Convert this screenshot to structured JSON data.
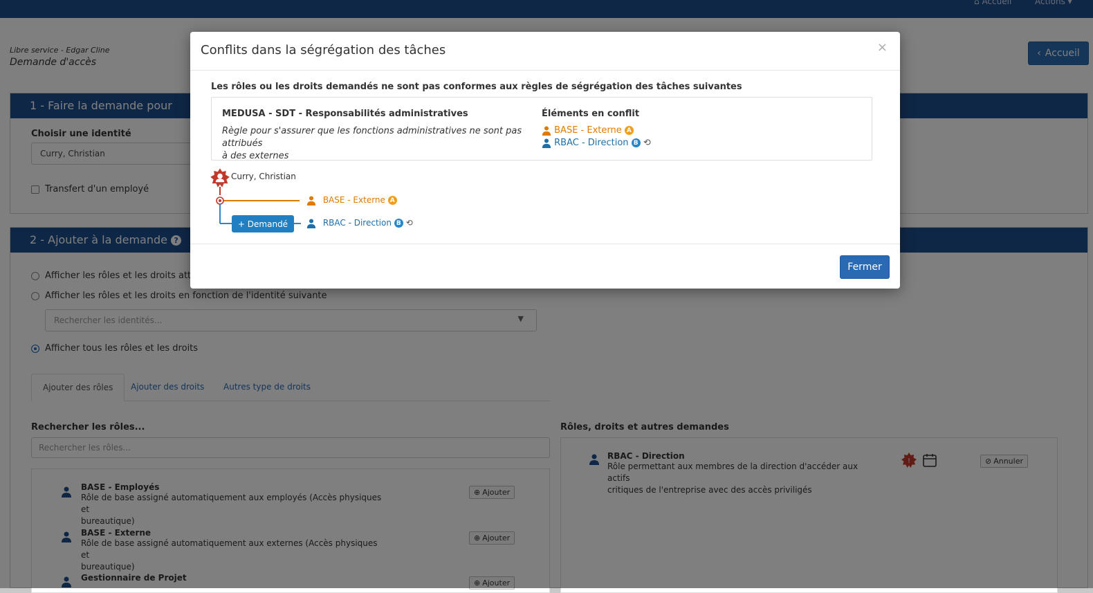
{
  "topbar": {
    "home_label": "Accueil",
    "actions_label": "Actions"
  },
  "breadcrumb": {
    "prefix": "Libre service",
    "separator": " - ",
    "user": "Edgar Cline"
  },
  "page_subtitle": "Demande d'accès",
  "home_button": "Accueil",
  "section1": {
    "title": "1 - Faire la demande pour",
    "identity_label": "Choisir une identité",
    "identity_value": "Curry, Christian",
    "transfer_label": "Transfert d'un employé"
  },
  "section2": {
    "title": "2 - Ajouter à la demande",
    "radio1": "Afficher les rôles et les droits attrib",
    "radio2": "Afficher les rôles et les droits en fonction de l'identité suivante",
    "identity_search_placeholder": "Rechercher les identités...",
    "radio3": "Afficher tous les rôles et les droits",
    "tabs": [
      "Ajouter des rôles",
      "Ajouter des droits",
      "Autres type de droits"
    ],
    "roles_search_label": "Rechercher les rôles...",
    "roles_search_placeholder": "Rechercher les rôles...",
    "roles": [
      {
        "name": "BASE - Employés",
        "desc1": "Rôle de base assigné automatiquement aux employés (Accès physiques et",
        "desc2": "bureautique)",
        "button": "Ajouter"
      },
      {
        "name": "BASE - Externe",
        "desc1": "Rôle de base assigné automatiquement aux externes (Accès physiques et",
        "desc2": "bureautique)",
        "button": "Ajouter"
      },
      {
        "name": "Gestionnaire de Projet",
        "desc1": "",
        "desc2": "",
        "button": "Ajouter"
      }
    ],
    "requests_label": "Rôles, droits et autres demandes",
    "request": {
      "name": "RBAC - Direction",
      "desc1": "Rôle permettant aux membres de la direction d'accéder aux actifs",
      "desc2": "critiques de l'entreprise avec des accès priviligés",
      "cancel": "Annuler"
    }
  },
  "modal": {
    "title": "Conflits dans la ségrégation des tâches",
    "close_symbol": "×",
    "intro": "Les rôles ou les droits demandés ne sont pas conformes aux règles de ségrégation des tâches suivantes",
    "rule_name": "MEDUSA - SDT - Responsabilités administratives",
    "rule_desc1": "Règle pour s'assurer que les fonctions administratives ne sont pas attribués",
    "rule_desc2": "à des externes",
    "conflict_header": "Éléments en conflit",
    "conflict1": "BASE - Externe",
    "conflict1_badge": "A",
    "conflict2": "RBAC - Direction",
    "conflict2_badge": "B",
    "graph": {
      "identity": "Curry, Christian",
      "item1": "BASE - Externe",
      "item1_badge": "A",
      "requested_label": "+ Demandé",
      "item2": "RBAC - Direction",
      "item2_badge": "B"
    },
    "close_button": "Fermer"
  },
  "colors": {
    "brand": "#1f4f8f",
    "primary": "#2a6ab3",
    "conflict_orange": "#e07b00",
    "role_blue": "#1f6fa8",
    "alert_red": "#c0392b"
  }
}
